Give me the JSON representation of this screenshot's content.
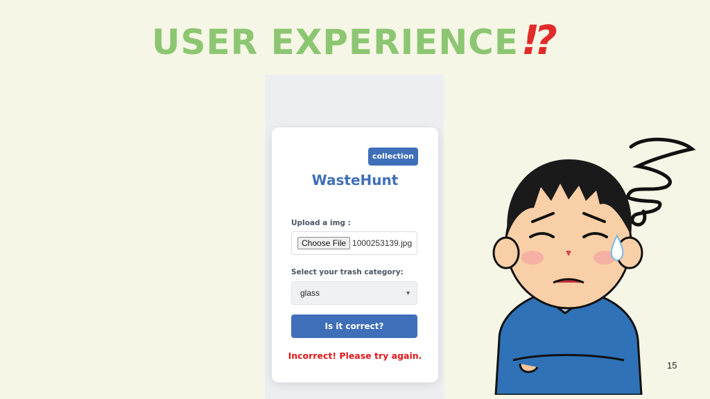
{
  "slide": {
    "title": "USER EXPERIENCE",
    "title_accent": "⁉",
    "page_number": "15"
  },
  "app": {
    "collection_button": "collection",
    "brand": "WasteHunt",
    "upload_label": "Upload a img :",
    "choose_file_button": "Choose File",
    "file_name": "1000253139.jpg",
    "category_label": "Select your trash category:",
    "category_selected": "glass",
    "submit_button": "Is it correct?",
    "error_message": "Incorrect! Please try again."
  },
  "colors": {
    "title": "#8cc672",
    "accent": "#e02b2b",
    "brand_blue": "#3f6fb8",
    "error": "#e0171a",
    "background": "#f6f6e6"
  },
  "icons": [
    "interrobang-icon",
    "chevron-down-icon",
    "confused-person-illustration",
    "scribble-icon"
  ]
}
